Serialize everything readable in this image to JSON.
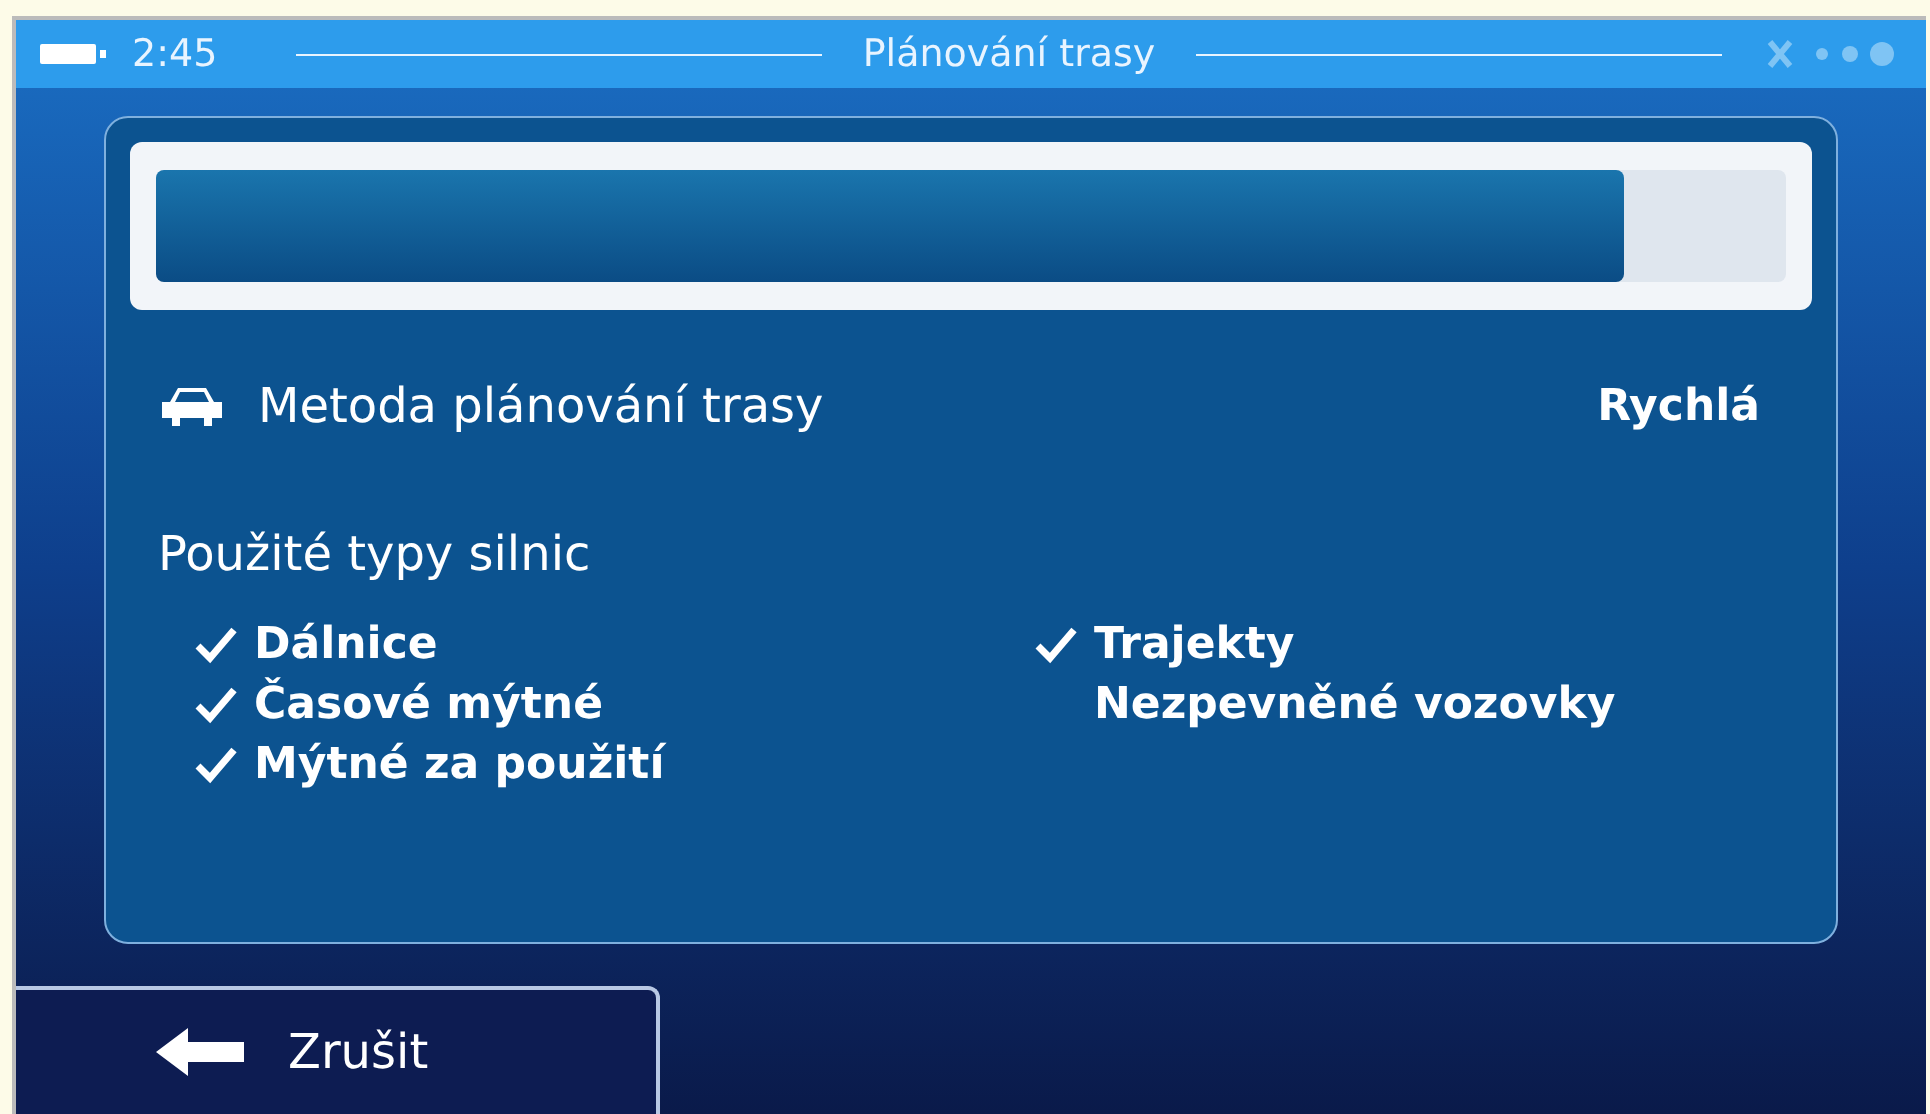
{
  "status_bar": {
    "time": "2:45",
    "title": "Plánování trasy"
  },
  "progress": {
    "level": 0.9
  },
  "method": {
    "label": "Metoda plánování trasy",
    "value": "Rychlá"
  },
  "road_types": {
    "heading": "Použité typy silnic",
    "items": [
      {
        "label": "Dálnice",
        "checked": true
      },
      {
        "label": "Časové mýtné",
        "checked": true
      },
      {
        "label": "Mýtné za použití",
        "checked": true
      },
      {
        "label": "Trajekty",
        "checked": true
      },
      {
        "label": "Nezpevněné vozovky",
        "checked": false
      }
    ]
  },
  "cancel_button": {
    "label": "Zrušit"
  }
}
